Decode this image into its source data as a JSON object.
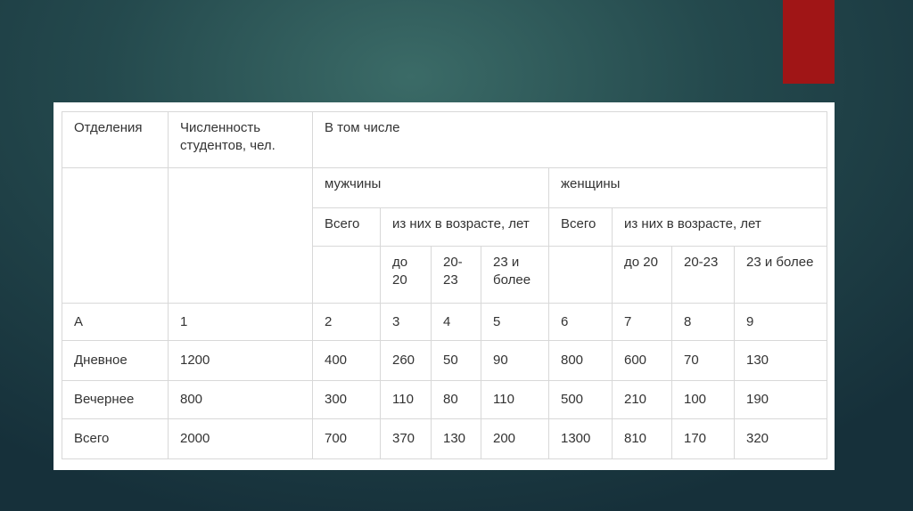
{
  "slide": {
    "accent_color": "#a01516",
    "background_color": "#24494d"
  },
  "table": {
    "header": {
      "departments": "Отделения",
      "student_count": "Численность студентов, чел.",
      "including": "В том числе",
      "men": "мужчины",
      "women": "женщины",
      "men_total": "Всего",
      "men_by_age": "из них в возрасте, лет",
      "women_total": "Всего",
      "women_by_age": "из них в возрасте, лет",
      "men_age_ranges": [
        "до 20",
        "20-23",
        "23 и более"
      ],
      "women_age_ranges": [
        "до 20",
        "20-23",
        "23 и более"
      ]
    },
    "column_numbers": [
      "А",
      "1",
      "2",
      "3",
      "4",
      "5",
      "6",
      "7",
      "8",
      "9"
    ],
    "rows": [
      [
        "Дневное",
        "1200",
        "400",
        "260",
        "50",
        "90",
        "800",
        "600",
        "70",
        "130"
      ],
      [
        "Вечернее",
        "800",
        "300",
        "110",
        "80",
        "110",
        "500",
        "210",
        "100",
        "190"
      ],
      [
        "Всего",
        "2000",
        "700",
        "370",
        "130",
        "200",
        "1300",
        "810",
        "170",
        "320"
      ]
    ]
  }
}
